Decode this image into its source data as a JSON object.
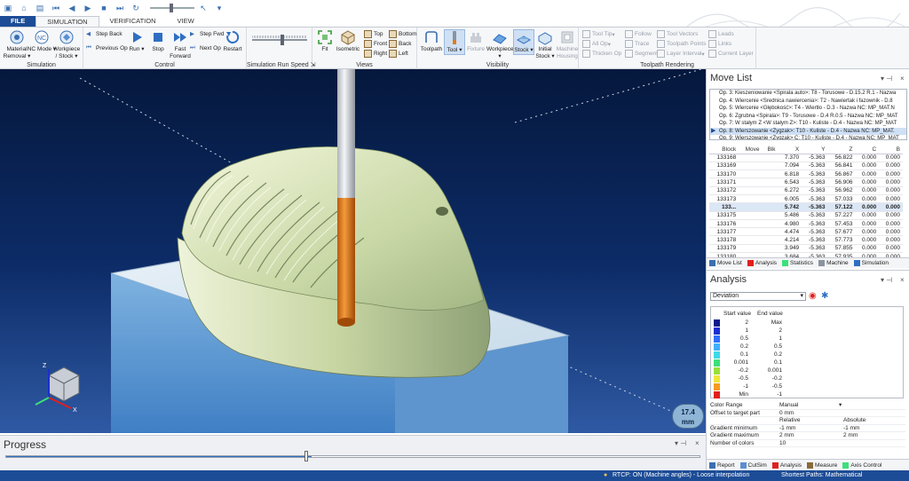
{
  "tabs": [
    "FILE",
    "SIMULATION",
    "VERIFICATION",
    "VIEW"
  ],
  "ribbon": {
    "simulation": {
      "label": "Simulation",
      "buttons": [
        "Material Removal",
        "NC Mode",
        "Workpiece / Stock"
      ]
    },
    "control": {
      "label": "Control",
      "step_back": "Step Back",
      "previous_op": "Previous Op",
      "run": "Run",
      "stop": "Stop",
      "fast_forward": "Fast Forward",
      "step_fwd": "Step Fwd",
      "next_op": "Next Op",
      "restart": "Restart"
    },
    "speed": {
      "label": "Simulation Run Speed",
      "value": 0.55
    },
    "views": {
      "label": "Views",
      "fit": "Fit",
      "isometric": "Isometric",
      "top": "Top",
      "front": "Front",
      "right": "Right",
      "bottom": "Bottom",
      "back": "Back",
      "left": "Left"
    },
    "visibility": {
      "label": "Visibility",
      "buttons": [
        "Toolpath",
        "Tool",
        "Fixture",
        "Workpiece",
        "Stock",
        "Initial Stock",
        "Machine Housing"
      ]
    },
    "rendering": {
      "label": "Toolpath Rendering",
      "tool_tip": "Tool Tip",
      "all_op": "All Op",
      "thicken_op": "Thicken Op",
      "follow": "Follow",
      "trace": "Trace",
      "segment": "Segment",
      "tool_vectors": "Tool Vectors",
      "toolpath_points": "Toolpath Points",
      "layer_interval": "Layer Interval",
      "leads": "Leads",
      "links": "Links",
      "current_layer": "Current Layer"
    }
  },
  "viewport": {
    "distance_value": "17.4",
    "distance_unit": "mm"
  },
  "progress": {
    "title": "Progress",
    "fraction": 0.44
  },
  "status": {
    "rtcp": "RTCP: ON (Machine angles) - Loose interpolation",
    "shortest": "Shortest Paths: Mathematical"
  },
  "movelist": {
    "title": "Move List",
    "ops": [
      "Op. 3: Kieszeniowanie <Spirala auto>: T8 - Torusowe - D.15.2 R.1 - Nazwa",
      "Op. 4: Wiercenie <Średnica nawiercenia>: T2 - Nawiertak i fazownik - D.8",
      "Op. 5: Wiercenie <Głębokość>: T4 - Wiertło - D.3 - Nazwa NC: MP_MAT.N",
      "Op. 6: Zgrubna <Spirala>: T9 - Torusowe - D.4 R.0.5 - Nazwa NC: MP_MAT",
      "Op. 7: W stałym Z <W stałym Z>: T10 - Kuliste - D.4 - Nazwa NC: MP_MAT",
      "Op. 8: Wierszowanie <Zygzak>: T10 - Kuliste - D.4 - Nazwa NC: MP_MAT.",
      "Op. 9: Wierszowanie <Zygzak> C: T10 - Kuliste - D.4 - Nazwa NC: MP_MAT"
    ],
    "active_op": 5,
    "columns": [
      "Block",
      "Move",
      "Blk",
      "X",
      "Y",
      "Z",
      "C",
      "B"
    ],
    "rows": [
      [
        "133168",
        "",
        "",
        "7.370",
        "-5.363",
        "56.822",
        "0.000",
        "0.000"
      ],
      [
        "133169",
        "",
        "",
        "7.094",
        "-5.363",
        "56.841",
        "0.000",
        "0.000"
      ],
      [
        "133170",
        "",
        "",
        "6.818",
        "-5.363",
        "56.867",
        "0.000",
        "0.000"
      ],
      [
        "133171",
        "",
        "",
        "6.543",
        "-5.363",
        "56.906",
        "0.000",
        "0.000"
      ],
      [
        "133172",
        "",
        "",
        "6.272",
        "-5.363",
        "56.962",
        "0.000",
        "0.000"
      ],
      [
        "133173",
        "",
        "",
        "6.005",
        "-5.363",
        "57.033",
        "0.000",
        "0.000"
      ],
      [
        "133...",
        "",
        "",
        "5.742",
        "-5.363",
        "57.122",
        "0.000",
        "0.000"
      ],
      [
        "133175",
        "",
        "",
        "5.486",
        "-5.363",
        "57.227",
        "0.000",
        "0.000"
      ],
      [
        "133176",
        "",
        "",
        "4.980",
        "-5.363",
        "57.453",
        "0.000",
        "0.000"
      ],
      [
        "133177",
        "",
        "",
        "4.474",
        "-5.363",
        "57.677",
        "0.000",
        "0.000"
      ],
      [
        "133178",
        "",
        "",
        "4.214",
        "-5.363",
        "57.773",
        "0.000",
        "0.000"
      ],
      [
        "133179",
        "",
        "",
        "3.949",
        "-5.363",
        "57.855",
        "0.000",
        "0.000"
      ],
      [
        "133180",
        "",
        "",
        "3.684",
        "-5.363",
        "57.935",
        "0.000",
        "0.000"
      ]
    ],
    "current_row": 6,
    "tabs": [
      "Move List",
      "Analysis",
      "Statistics",
      "Machine",
      "Simulation"
    ]
  },
  "analysis": {
    "title": "Analysis",
    "mode": "Deviation",
    "start_header": "Start value",
    "end_header": "End value",
    "rows": [
      {
        "color": "#0a1a8c",
        "start": "2",
        "end": "Max"
      },
      {
        "color": "#1b2fd1",
        "start": "1",
        "end": "2"
      },
      {
        "color": "#2f6fff",
        "start": "0.5",
        "end": "1"
      },
      {
        "color": "#3fb0ff",
        "start": "0.2",
        "end": "0.5"
      },
      {
        "color": "#40d8e8",
        "start": "0.1",
        "end": "0.2"
      },
      {
        "color": "#3ce07a",
        "start": "0.001",
        "end": "0.1"
      },
      {
        "color": "#9be03a",
        "start": "-0.2",
        "end": "0.001"
      },
      {
        "color": "#f0e63a",
        "start": "-0.5",
        "end": "-0.2"
      },
      {
        "color": "#f59a22",
        "start": "-1",
        "end": "-0.5"
      },
      {
        "color": "#e0201c",
        "start": "Min",
        "end": "-1"
      }
    ],
    "props": {
      "color_range": "Color Range",
      "color_range_val": "Manual",
      "offset": "Offset to target part",
      "offset_val": "0 mm",
      "relative": "Relative",
      "absolute": "Absolute",
      "gmin": "Gradient minimum",
      "gmin_rel": "-1 mm",
      "gmin_abs": "-1 mm",
      "gmax": "Gradient maximum",
      "gmax_rel": "2 mm",
      "gmax_abs": "2 mm",
      "ncolors": "Number of colors",
      "ncolors_val": "10"
    },
    "tabs": [
      "Report",
      "CutSim",
      "Analysis",
      "Measure",
      "Axis Control"
    ]
  }
}
